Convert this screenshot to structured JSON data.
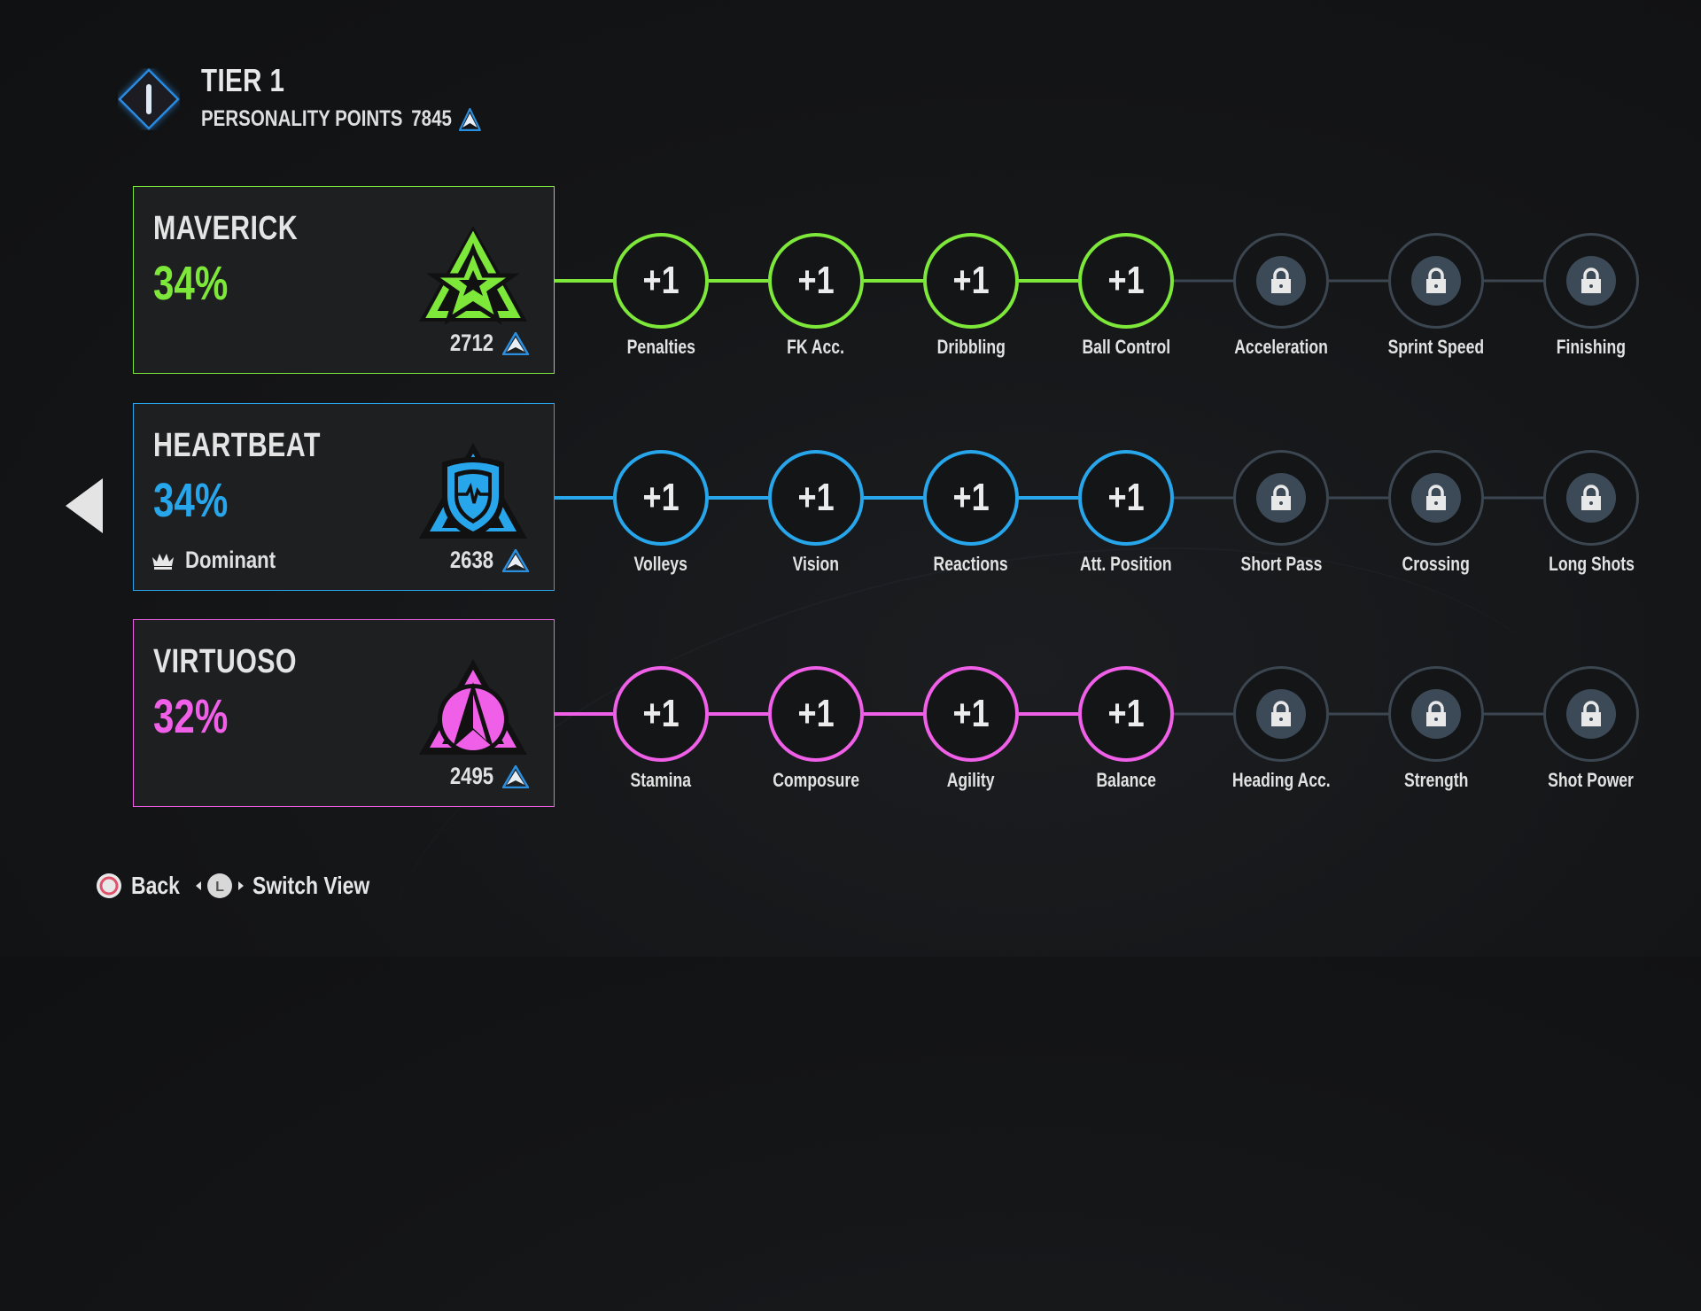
{
  "header": {
    "tier_label": "TIER 1",
    "points_label": "PERSONALITY POINTS",
    "points_value": "7845",
    "tier_icon": "tier-diamond-icon",
    "points_icon": "personality-triangle-icon"
  },
  "colors": {
    "maverick": "#7ee83a",
    "heartbeat": "#27a6ec",
    "virtuoso": "#ef5fe8",
    "locked": "#3b4651",
    "points_icon": "#2b8fe0"
  },
  "archetypes": [
    {
      "key": "maverick",
      "name": "MAVERICK",
      "percent": "34%",
      "points": "2712",
      "badge": null,
      "emblem": "star-emblem-icon",
      "nodes": [
        {
          "label": "Penalties",
          "value": "+1",
          "locked": false
        },
        {
          "label": "FK Acc.",
          "value": "+1",
          "locked": false
        },
        {
          "label": "Dribbling",
          "value": "+1",
          "locked": false
        },
        {
          "label": "Ball Control",
          "value": "+1",
          "locked": false
        },
        {
          "label": "Acceleration",
          "value": "",
          "locked": true
        },
        {
          "label": "Sprint Speed",
          "value": "",
          "locked": true
        },
        {
          "label": "Finishing",
          "value": "",
          "locked": true
        }
      ]
    },
    {
      "key": "heartbeat",
      "name": "HEARTBEAT",
      "percent": "34%",
      "points": "2638",
      "badge": "Dominant",
      "emblem": "shield-heartbeat-emblem-icon",
      "nodes": [
        {
          "label": "Volleys",
          "value": "+1",
          "locked": false
        },
        {
          "label": "Vision",
          "value": "+1",
          "locked": false
        },
        {
          "label": "Reactions",
          "value": "+1",
          "locked": false
        },
        {
          "label": "Att. Position",
          "value": "+1",
          "locked": false
        },
        {
          "label": "Short Pass",
          "value": "",
          "locked": true
        },
        {
          "label": "Crossing",
          "value": "",
          "locked": true
        },
        {
          "label": "Long Shots",
          "value": "",
          "locked": true
        }
      ]
    },
    {
      "key": "virtuoso",
      "name": "VIRTUOSO",
      "percent": "32%",
      "points": "2495",
      "badge": null,
      "emblem": "arrow-circle-emblem-icon",
      "nodes": [
        {
          "label": "Stamina",
          "value": "+1",
          "locked": false
        },
        {
          "label": "Composure",
          "value": "+1",
          "locked": false
        },
        {
          "label": "Agility",
          "value": "+1",
          "locked": false
        },
        {
          "label": "Balance",
          "value": "+1",
          "locked": false
        },
        {
          "label": "Heading Acc.",
          "value": "",
          "locked": true
        },
        {
          "label": "Strength",
          "value": "",
          "locked": true
        },
        {
          "label": "Shot Power",
          "value": "",
          "locked": true
        }
      ]
    }
  ],
  "footer": {
    "back_label": "Back",
    "back_button_glyph": "circle-button-icon",
    "switch_label": "Switch View",
    "switch_button_glyph": "L",
    "switch_stick_icon": "left-stick-icon"
  },
  "nav": {
    "prev_icon": "left-arrow-icon"
  }
}
